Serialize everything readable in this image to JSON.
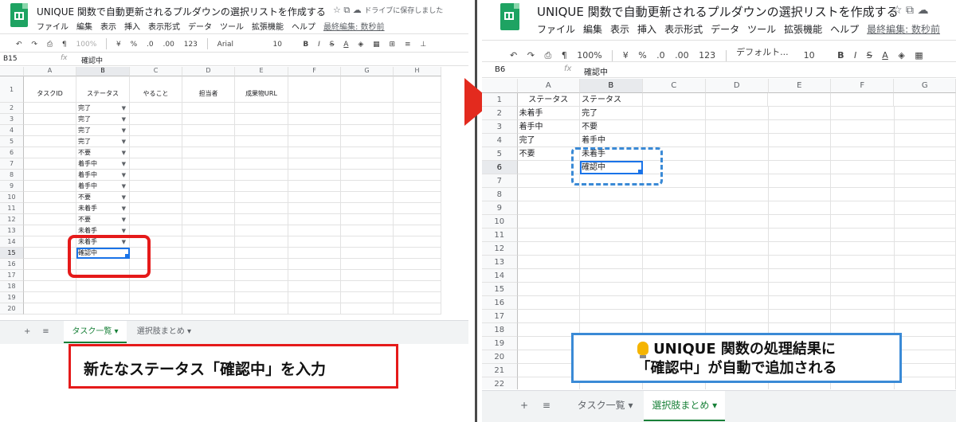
{
  "colors": {
    "arrow": "#e32a1e",
    "red_frame": "#e51a1a",
    "blue_frame": "#3a8ad6",
    "selection": "#1a73e8",
    "active_tab": "#188038"
  },
  "left": {
    "title": "UNIQUE 関数で自動更新されるプルダウンの選択リストを作成する",
    "saved_status": "ドライブに保存しました",
    "menu": [
      "ファイル",
      "編集",
      "表示",
      "挿入",
      "表示形式",
      "データ",
      "ツール",
      "拡張機能",
      "ヘルプ"
    ],
    "last_edit": "最終編集: 数秒前",
    "toolbar": {
      "zoom": "100%",
      "currency": "¥",
      "percent": "%",
      "dec_less": ".0",
      "dec_more": ".00",
      "format": "123",
      "font": "Arial",
      "font_size": "10",
      "bold": "B",
      "italic": "I",
      "strike": "S",
      "text_color": "A"
    },
    "cell_ref": "B15",
    "formula_value": "確認中",
    "columns": [
      "A",
      "B",
      "C",
      "D",
      "E",
      "F",
      "G",
      "H"
    ],
    "header_row": [
      "タスクID",
      "ステータス",
      "やること",
      "担当者",
      "成果物URL",
      "",
      "",
      ""
    ],
    "row_numbers": [
      "1",
      "2",
      "3",
      "4",
      "5",
      "6",
      "7",
      "8",
      "9",
      "10",
      "11",
      "12",
      "13",
      "14",
      "15",
      "16",
      "17",
      "18",
      "19",
      "20"
    ],
    "status_values": [
      "完了",
      "完了",
      "完了",
      "完了",
      "不要",
      "着手中",
      "着手中",
      "着手中",
      "不要",
      "未着手",
      "不要",
      "未着手",
      "未着手",
      "確認中"
    ],
    "tabs": [
      "タスク一覧",
      "選択肢まとめ"
    ],
    "callout": "新たなステータス「確認中」を入力"
  },
  "right": {
    "title": "UNIQUE 関数で自動更新されるプルダウンの選択リストを作成する",
    "menu": [
      "ファイル",
      "編集",
      "表示",
      "挿入",
      "表示形式",
      "データ",
      "ツール",
      "拡張機能",
      "ヘルプ"
    ],
    "last_edit": "最終編集: 数秒前",
    "toolbar": {
      "zoom": "100%",
      "currency": "¥",
      "percent": "%",
      "dec_less": ".0",
      "dec_more": ".00",
      "format": "123",
      "font": "デフォルト...",
      "font_size": "10",
      "bold": "B",
      "italic": "I",
      "strike": "S",
      "text_color": "A"
    },
    "cell_ref": "B6",
    "formula_value": "確認中",
    "columns": [
      "A",
      "B",
      "C",
      "D",
      "E",
      "F",
      "G"
    ],
    "row_numbers": [
      "1",
      "2",
      "3",
      "4",
      "5",
      "6",
      "7",
      "8",
      "9",
      "10",
      "11",
      "12",
      "13",
      "14",
      "15",
      "16",
      "17",
      "18",
      "19",
      "20",
      "21",
      "22"
    ],
    "col_a": [
      "ステータス",
      "未着手",
      "着手中",
      "完了",
      "不要"
    ],
    "col_b": [
      "ステータス",
      "完了",
      "不要",
      "着手中",
      "未着手",
      "確認中"
    ],
    "tabs": [
      "タスク一覧",
      "選択肢まとめ"
    ],
    "callout_line1": "UNIQUE 関数の処理結果に",
    "callout_line2": "「確認中」が自動で追加される"
  }
}
